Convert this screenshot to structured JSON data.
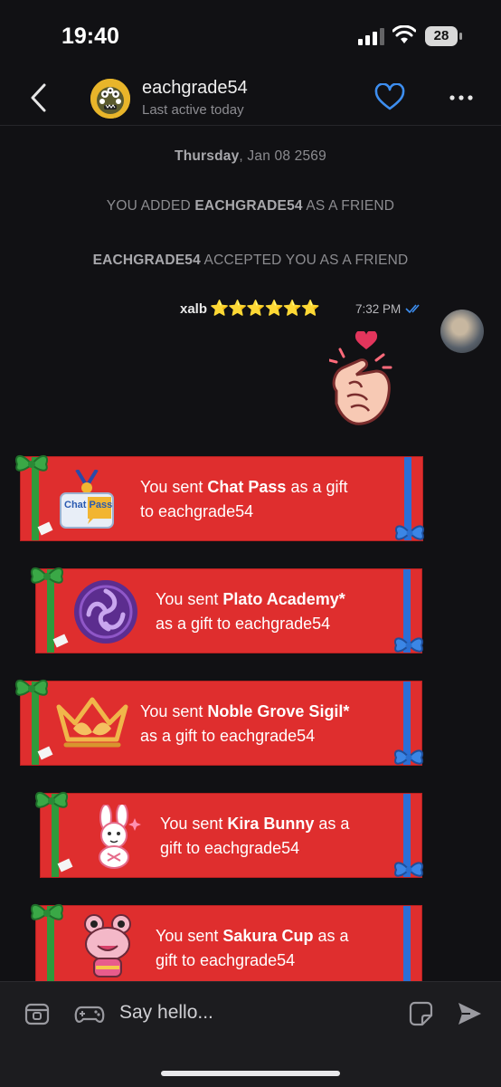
{
  "status_bar": {
    "time": "19:40",
    "battery": "28"
  },
  "header": {
    "name": "eachgrade54",
    "subtitle": "Last active today"
  },
  "date_line": {
    "day": "Thursday",
    "rest": ", Jan 08 2569"
  },
  "system_messages": [
    {
      "pre": "YOU ADDED ",
      "bold": "EACHGRADE54",
      "post": " AS A FRIEND"
    },
    {
      "pre": "",
      "bold": "EACHGRADE54",
      "post": " ACCEPTED YOU AS A FRIEND"
    }
  ],
  "message": {
    "sender": "xalb",
    "stars": "⭐⭐⭐⭐⭐⭐",
    "time": "7:32 PM"
  },
  "gifts": [
    {
      "pre": "You sent ",
      "name": "Chat Pass",
      "line1_post": " as a gift",
      "line2": "to eachgrade54",
      "icon": "chat-pass-icon",
      "icon_text": "Chat Pass"
    },
    {
      "pre": "You sent ",
      "name": "Plato Academy*",
      "line1_post": "",
      "line2": "as a gift to eachgrade54",
      "icon": "plato-academy-icon"
    },
    {
      "pre": "You sent ",
      "name": "Noble Grove Sigil*",
      "line1_post": "",
      "line2": "as a gift to eachgrade54",
      "icon": "noble-grove-crown-icon"
    },
    {
      "pre": "You sent ",
      "name": "Kira Bunny",
      "line1_post": " as a",
      "line2": "gift to eachgrade54",
      "icon": "kira-bunny-icon"
    },
    {
      "pre": "You sent ",
      "name": "Sakura Cup",
      "line1_post": " as a",
      "line2": "gift to eachgrade54",
      "icon": "sakura-cup-icon"
    }
  ],
  "input": {
    "placeholder": "Say hello..."
  },
  "colors": {
    "background": "#111114",
    "gift_red": "#df2e2e",
    "accent_blue": "#3d8ef0",
    "ribbon_green": "#2f9a3b"
  }
}
